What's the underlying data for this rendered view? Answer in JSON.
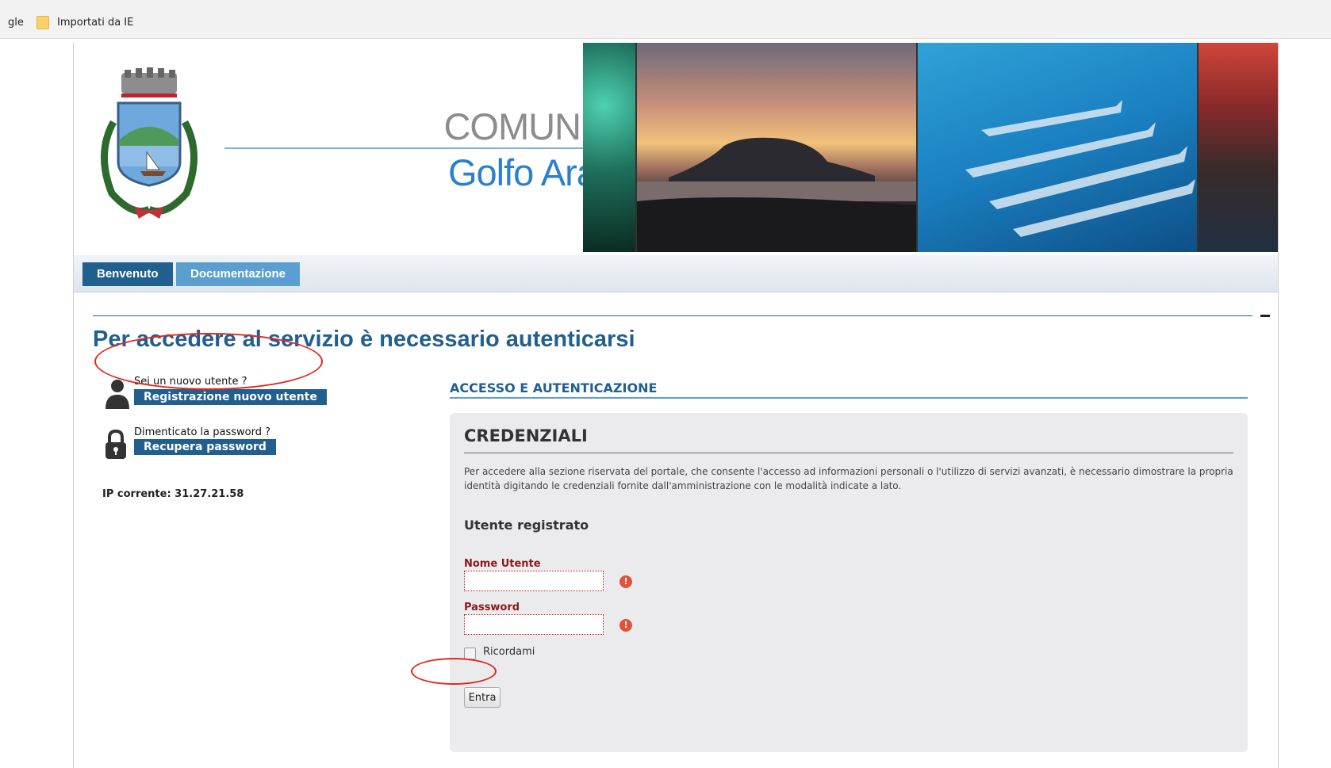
{
  "bookmarks": {
    "items": [
      {
        "label": "gle"
      },
      {
        "label": "Importati da IE"
      }
    ]
  },
  "header": {
    "title_line1": "COMUNE di",
    "title_line2": "Golfo Aranci",
    "crest_icon": "coat-of-arms-icon"
  },
  "nav": {
    "tabs": [
      {
        "label": "Benvenuto",
        "active": true
      },
      {
        "label": "Documentazione",
        "active": false
      }
    ]
  },
  "main": {
    "page_title": "Per accedere al servizio è necessario autenticarsi"
  },
  "sidebar": {
    "new_user_question": "Sei un nuovo utente ?",
    "new_user_button": "Registrazione nuovo utente",
    "forgot_question": "Dimenticato la password ?",
    "forgot_button": "Recupera password",
    "ip_label": "IP corrente: 31.27.21.58"
  },
  "login": {
    "section_title": "ACCESSO E AUTENTICAZIONE",
    "panel_title": "CREDENZIALI",
    "description": "Per accedere alla sezione riservata del portale, che consente l'accesso ad informazioni personali o l'utilizzo di servizi avanzati, è necessario dimostrare la propria identità digitando le credenziali fornite dall'amministrazione con le modalità indicate a lato.",
    "subtitle": "Utente registrato",
    "username_label": "Nome Utente",
    "username_value": "",
    "password_label": "Password",
    "password_value": "",
    "remember_label": "Ricordami",
    "remember_checked": false,
    "submit_label": "Entra"
  },
  "colors": {
    "brand_dark": "#215f8f",
    "brand_light": "#5b9fd1",
    "error": "#e0533a",
    "annotation": "#e0281e"
  }
}
